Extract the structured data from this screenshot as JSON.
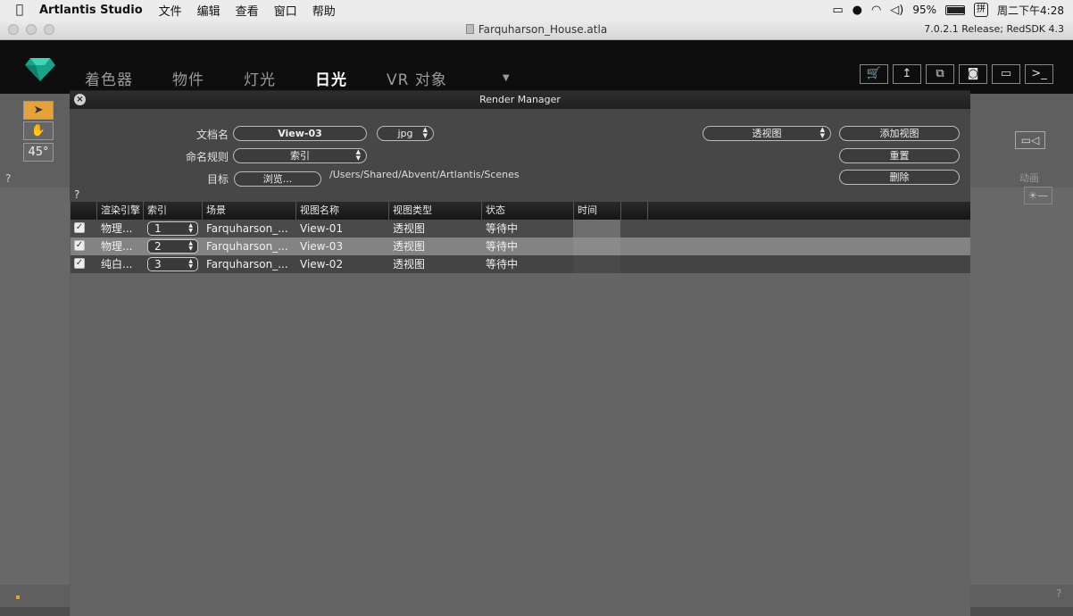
{
  "menubar": {
    "app_name": "Artlantis Studio",
    "menus": [
      "文件",
      "编辑",
      "查看",
      "窗口",
      "帮助"
    ],
    "battery": "95%",
    "ime": "拼",
    "clock": "周二下午4:28"
  },
  "window": {
    "title": "Farquharson_House.atla",
    "version": "7.0.2.1 Release; RedSDK 4.3"
  },
  "app_tabs": [
    {
      "label": "着色器",
      "active": false
    },
    {
      "label": "物件",
      "active": false
    },
    {
      "label": "灯光",
      "active": false
    },
    {
      "label": "日光",
      "active": true
    },
    {
      "label": "VR 对象",
      "active": false
    }
  ],
  "left_toolbar": {
    "angle": "45°"
  },
  "right_panel": {
    "animation_label": "动画"
  },
  "render_manager": {
    "title": "Render Manager",
    "doc_name_label": "文档名",
    "doc_name_value": "View-03",
    "format_value": "jpg",
    "naming_label": "命名规则",
    "naming_value": "索引",
    "target_label": "目标",
    "browse_label": "浏览...",
    "target_path": "/Users/Shared/Abvent/Artlantis/Scenes",
    "view_type_select": "透视图",
    "add_view_label": "添加视图",
    "reset_label": "重置",
    "delete_label": "删除",
    "help": "?",
    "columns": [
      "渲染引擎",
      "索引",
      "场景",
      "视图名称",
      "视图类型",
      "状态",
      "时间"
    ],
    "rows": [
      {
        "checked": true,
        "engine": "物理...",
        "index": "1",
        "scene": "Farquharson_...",
        "view_name": "View-01",
        "view_type": "透视图",
        "status": "等待中",
        "time": ""
      },
      {
        "checked": true,
        "engine": "物理...",
        "index": "2",
        "scene": "Farquharson_...",
        "view_name": "View-03",
        "view_type": "透视图",
        "status": "等待中",
        "time": ""
      },
      {
        "checked": true,
        "engine": "纯白...",
        "index": "3",
        "scene": "Farquharson_...",
        "view_name": "View-02",
        "view_type": "透视图",
        "status": "等待中",
        "time": ""
      }
    ],
    "selected_row": 1
  },
  "colors": {
    "accent": "#e5a13a",
    "header_bg": "#0e0e0e",
    "panel_bg": "#5d5d5d",
    "selected_row": "#838383"
  }
}
